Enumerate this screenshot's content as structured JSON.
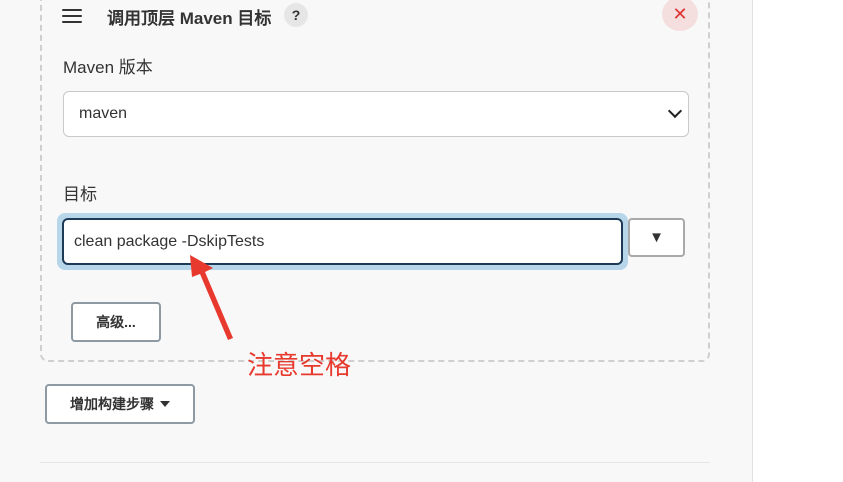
{
  "step": {
    "title": "调用顶层 Maven 目标",
    "help_glyph": "?",
    "close_glyph": "✕"
  },
  "maven_version": {
    "label": "Maven 版本",
    "selected": "maven"
  },
  "goals": {
    "label": "目标",
    "value": "clean package -DskipTests",
    "dropdown_glyph": "▼"
  },
  "advanced_button": "高级...",
  "add_step_button": "增加构建步骤",
  "annotation": {
    "text": "注意空格",
    "color": "#e8392e"
  }
}
